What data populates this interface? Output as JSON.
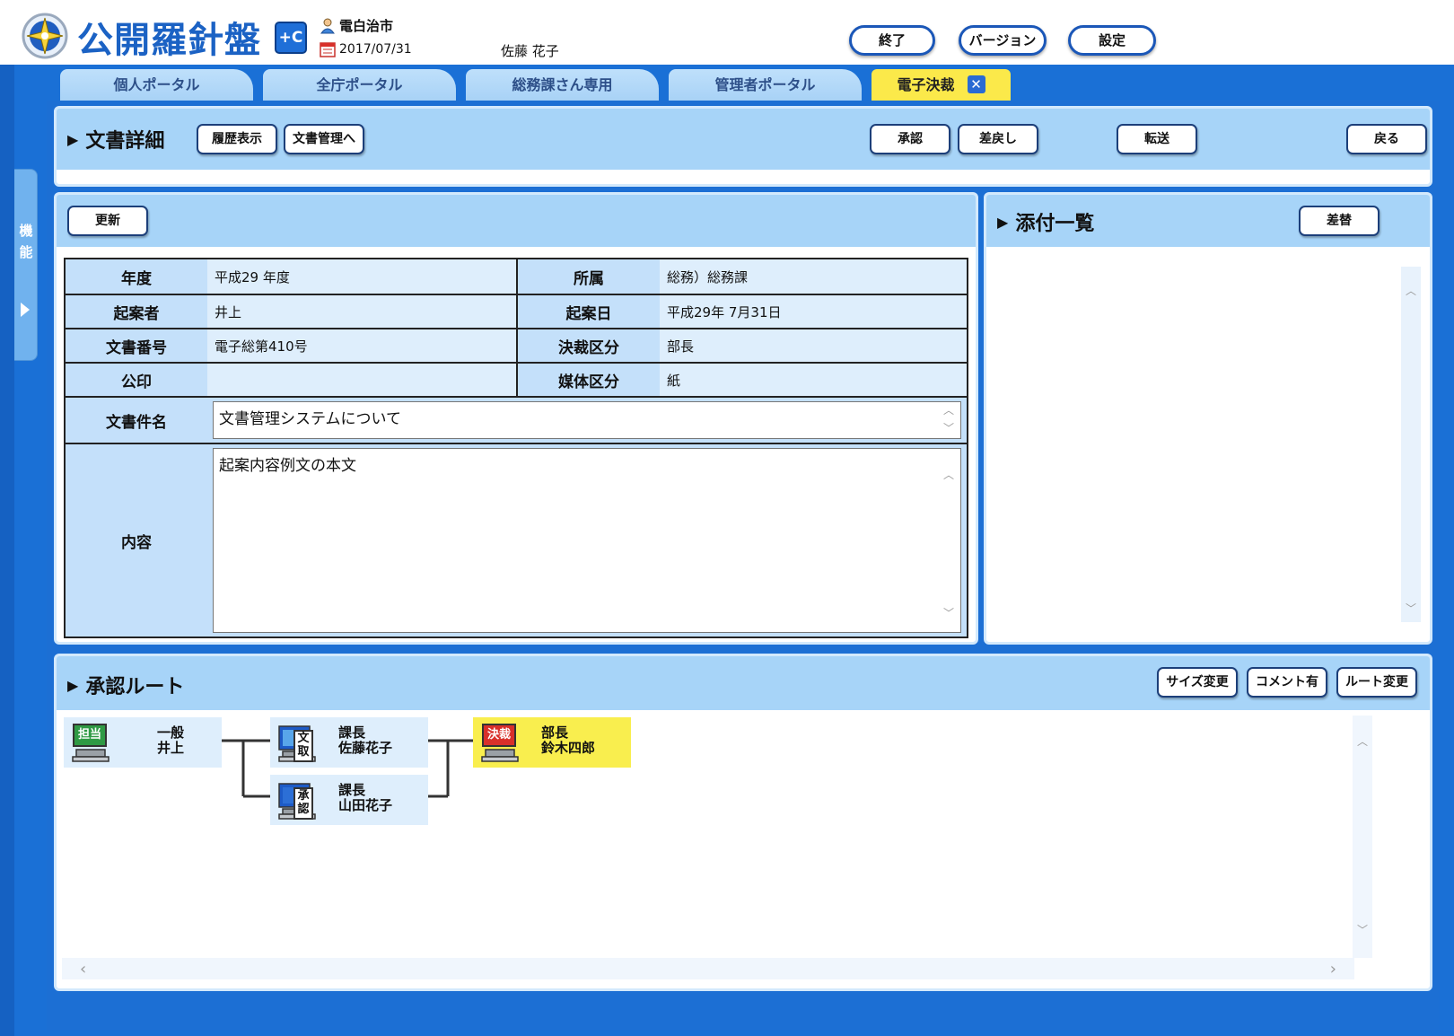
{
  "app": {
    "title": "公開羅針盤",
    "badge": "+C"
  },
  "header": {
    "org": "電白治市",
    "date": "2017/07/31",
    "user": "佐藤 花子",
    "buttons": {
      "exit": "終了",
      "version": "バージョン",
      "settings": "設定"
    }
  },
  "sidebar": {
    "label": "機能"
  },
  "tabs": [
    {
      "label": "個人ポータル"
    },
    {
      "label": "全庁ポータル"
    },
    {
      "label": "総務課さん専用"
    },
    {
      "label": "管理者ポータル"
    },
    {
      "label": "電子決裁",
      "close": "✕"
    }
  ],
  "detail": {
    "title": "文書詳細",
    "history_button": "履歴表示",
    "docmgmt_button": "文書管理へ",
    "approve_button": "承認",
    "return_button": "差戻し",
    "forward_button": "転送",
    "back_button": "戻る"
  },
  "form": {
    "update_button": "更新",
    "fields": {
      "year": {
        "label": "年度",
        "value": "平成29 年度"
      },
      "affiliation": {
        "label": "所属",
        "value": "総務）総務課"
      },
      "drafter": {
        "label": "起案者",
        "value": "井上"
      },
      "draft_date": {
        "label": "起案日",
        "value": "平成29年 7月31日"
      },
      "doc_number": {
        "label": "文書番号",
        "value": "電子総第410号"
      },
      "decision_class": {
        "label": "決裁区分",
        "value": "部長"
      },
      "seal": {
        "label": "公印",
        "value": ""
      },
      "media_class": {
        "label": "媒体区分",
        "value": "紙"
      },
      "subject": {
        "label": "文書件名",
        "value": "文書管理システムについて"
      },
      "content": {
        "label": "内容",
        "value": "起案内容例文の本文"
      }
    }
  },
  "attachments": {
    "title": "添付一覧",
    "replace_button": "差替"
  },
  "route": {
    "title": "承認ルート",
    "resize_button": "サイズ変更",
    "comment_button": "コメント有",
    "route_change_button": "ルート変更",
    "nodes": [
      {
        "badge": "担当",
        "title": "一般",
        "name": "井上"
      },
      {
        "badge": "文取",
        "title": "課長",
        "name": "佐藤花子"
      },
      {
        "badge": "承認",
        "title": "課長",
        "name": "山田花子"
      },
      {
        "badge": "決裁",
        "title": "部長",
        "name": "鈴木四郎"
      }
    ]
  },
  "colors": {
    "frame_blue": "#1a70d6",
    "panel_header": "#a7d4f8",
    "active_tab": "#fbe94a",
    "label_cell": "#c4e0fa",
    "value_cell": "#deeefc",
    "badge_green": "#2f9a44",
    "badge_red": "#d8302a",
    "monitor_blue": "#1d5bc7"
  },
  "icons": {
    "logo": "compass-emblem",
    "org": "person-icon",
    "date": "calendar-icon",
    "route_terminal": "computer-terminal-icon"
  }
}
